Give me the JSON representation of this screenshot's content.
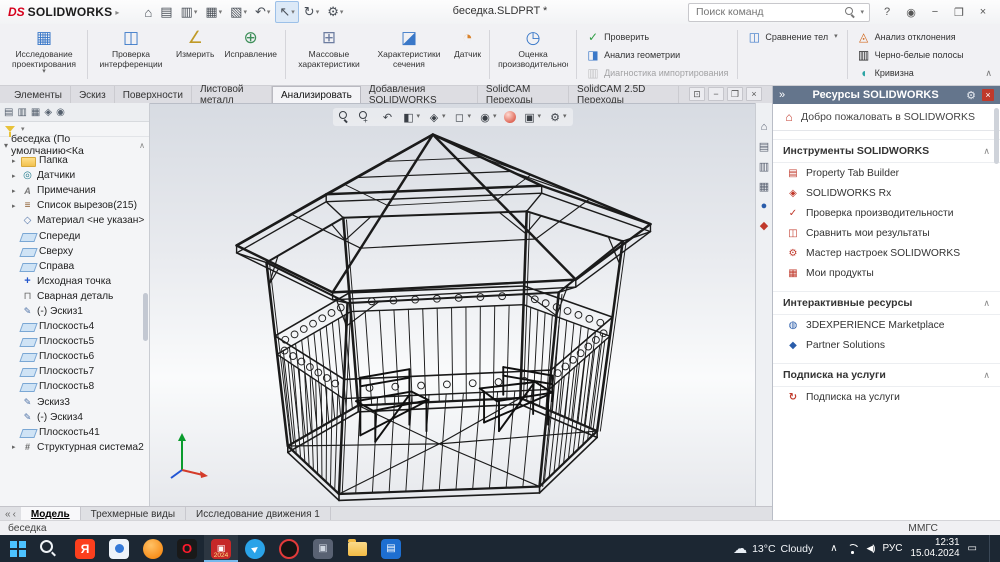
{
  "titlebar": {
    "brand_mark": "DS",
    "brand": "SOLIDWORKS",
    "doc_title": "беседка.SLDPRT *",
    "search_placeholder": "Поиск команд",
    "tools": [
      {
        "name": "home-icon",
        "glyph": "⌂"
      },
      {
        "name": "new-document-icon",
        "glyph": "▤"
      },
      {
        "name": "open-icon",
        "glyph": "▥",
        "dropdown": true
      },
      {
        "name": "save-icon",
        "glyph": "▦",
        "dropdown": true
      },
      {
        "name": "print-icon",
        "glyph": "▧",
        "dropdown": true
      },
      {
        "name": "undo-icon",
        "glyph": "↶",
        "dropdown": true
      },
      {
        "name": "select-icon",
        "glyph": "↖",
        "active": true,
        "dropdown": true
      },
      {
        "name": "rebuild-icon",
        "glyph": "↻",
        "dropdown": true
      },
      {
        "name": "options-icon",
        "glyph": "⚙",
        "dropdown": true
      }
    ],
    "window_controls": [
      {
        "name": "help-icon",
        "glyph": "?"
      },
      {
        "name": "user-icon",
        "glyph": "◉"
      },
      {
        "name": "minimize-icon",
        "glyph": "−"
      },
      {
        "name": "maximize-icon",
        "glyph": "❐"
      },
      {
        "name": "close-icon",
        "glyph": "×"
      }
    ]
  },
  "ribbon": {
    "groups": [
      [
        {
          "label": "Исследование проектирования",
          "icon": "design-study-icon",
          "dropdown": true
        }
      ],
      [
        {
          "label": "Проверка интерференции",
          "icon": "interference-check-icon"
        },
        {
          "label": "Измерить",
          "icon": "measure-icon"
        },
        {
          "label": "Исправление",
          "icon": "repair-icon"
        }
      ],
      [
        {
          "label": "Массовые характеристики",
          "icon": "mass-properties-icon"
        },
        {
          "label": "Характеристики сечения",
          "icon": "section-properties-icon"
        },
        {
          "label": "Датчик",
          "icon": "sensor-icon"
        }
      ],
      [
        {
          "label": "Оценка производительности",
          "icon": "performance-evaluation-icon"
        }
      ]
    ],
    "small_columns": [
      [
        {
          "label": "Проверить",
          "icon": "verify-icon"
        },
        {
          "label": "Анализ геометрии",
          "icon": "geometry-analysis-icon"
        },
        {
          "label": "Диагностика импортирования",
          "icon": "import-diagnostics-icon",
          "disabled": true
        }
      ],
      [
        {
          "label": "Сравнение тел",
          "icon": "compare-bodies-icon",
          "dropdown": true
        }
      ],
      [
        {
          "label": "Анализ отклонения",
          "icon": "deviation-analysis-icon"
        },
        {
          "label": "Черно-белые полосы",
          "icon": "zebra-stripes-icon"
        },
        {
          "label": "Кривизна",
          "icon": "curvature-icon"
        }
      ]
    ],
    "collapse_glyph": "∧"
  },
  "tabs": [
    {
      "label": "Элементы"
    },
    {
      "label": "Эскиз"
    },
    {
      "label": "Поверхности"
    },
    {
      "label": "Листовой металл"
    },
    {
      "label": "Анализировать",
      "active": true
    },
    {
      "label": "Добавления SOLIDWORKS"
    },
    {
      "label": "SolidCAM Переходы"
    },
    {
      "label": "SolidCAM 2.5D Переходы"
    }
  ],
  "doc_window_controls": [
    {
      "name": "doc-restore-icon",
      "glyph": "⊡"
    },
    {
      "name": "doc-minimize-icon",
      "glyph": "−"
    },
    {
      "name": "doc-maximize-icon",
      "glyph": "❐"
    },
    {
      "name": "doc-close-icon",
      "glyph": "×"
    }
  ],
  "feature_manager": {
    "root": "беседка (По умолчанию<Ка",
    "root_collapse_glyph": "∧",
    "tabs": [
      {
        "name": "feature-manager-tab-icon",
        "glyph": "▤"
      },
      {
        "name": "property-manager-tab-icon",
        "glyph": "▥"
      },
      {
        "name": "configuration-manager-tab-icon",
        "glyph": "▦"
      },
      {
        "name": "dimxpert-tab-icon",
        "glyph": "◈"
      },
      {
        "name": "display-manager-tab-icon",
        "glyph": "◉"
      }
    ],
    "items": [
      {
        "label": "Папка",
        "icon": "folder-icon",
        "expand": true
      },
      {
        "label": "Датчики",
        "icon": "sensors-icon",
        "expand": true
      },
      {
        "label": "Примечания",
        "icon": "annotations-folder-icon",
        "expand": true
      },
      {
        "label": "Список вырезов(215)",
        "icon": "cutlist-icon",
        "expand": true
      },
      {
        "label": "Материал <не указан>",
        "icon": "material-icon"
      },
      {
        "label": "Спереди",
        "icon": "plane-icon"
      },
      {
        "label": "Сверху",
        "icon": "plane-icon"
      },
      {
        "label": "Справа",
        "icon": "plane-icon"
      },
      {
        "label": "Исходная точка",
        "icon": "origin-icon"
      },
      {
        "label": "Сварная деталь",
        "icon": "weldment-icon"
      },
      {
        "label": "(-) Эскиз1",
        "icon": "sketch-icon"
      },
      {
        "label": "Плоскость4",
        "icon": "plane-icon"
      },
      {
        "label": "Плоскость5",
        "icon": "plane-icon"
      },
      {
        "label": "Плоскость6",
        "icon": "plane-icon"
      },
      {
        "label": "Плоскость7",
        "icon": "plane-icon"
      },
      {
        "label": "Плоскость8",
        "icon": "plane-icon"
      },
      {
        "label": "Эскиз3",
        "icon": "sketch-icon"
      },
      {
        "label": "(-) Эскиз4",
        "icon": "sketch-icon"
      },
      {
        "label": "Плоскость41",
        "icon": "plane-icon"
      },
      {
        "label": "Структурная система2",
        "icon": "structure-system-icon",
        "expand": true
      }
    ]
  },
  "viewport": {
    "toolbar": [
      {
        "name": "zoom-fit-icon",
        "style": "mag"
      },
      {
        "name": "zoom-area-icon",
        "style": "magp"
      },
      {
        "name": "previous-view-icon",
        "glyph": "↶"
      },
      {
        "name": "section-view-icon",
        "glyph": "◧",
        "dropdown": true
      },
      {
        "name": "annotations-visibility-icon",
        "glyph": "◈",
        "dropdown": true
      },
      {
        "name": "display-style-icon",
        "glyph": "◻",
        "dropdown": true
      },
      {
        "name": "hide-show-items-icon",
        "glyph": "◉",
        "dropdown": true
      },
      {
        "name": "edit-appearance-icon",
        "style": "ball"
      },
      {
        "name": "scene-icon",
        "glyph": "▣",
        "dropdown": true
      },
      {
        "name": "view-settings-icon",
        "glyph": "⚙",
        "dropdown": true
      }
    ]
  },
  "task_pane_strip": [
    {
      "name": "resources-tab-icon",
      "glyph": "⌂"
    },
    {
      "name": "design-library-icon",
      "glyph": "▤"
    },
    {
      "name": "file-explorer-tab-icon",
      "glyph": "▥"
    },
    {
      "name": "view-palette-icon",
      "glyph": "▦"
    },
    {
      "name": "appearances-icon",
      "glyph": "●",
      "cls": "blue"
    },
    {
      "name": "custom-properties-icon",
      "glyph": "◆",
      "cls": "red"
    }
  ],
  "task_pane": {
    "chevrons": "»",
    "title": "Ресурсы SOLIDWORKS",
    "welcome": {
      "label": "Добро пожаловать в SOLIDWORKS",
      "icon": "welcome-home-icon"
    },
    "sections": [
      {
        "title": "Инструменты SOLIDWORKS",
        "caret": "∧",
        "items": [
          {
            "label": "Property Tab Builder",
            "icon": "property-tab-builder-icon"
          },
          {
            "label": "SOLIDWORKS Rx",
            "icon": "solidworks-rx-icon"
          },
          {
            "label": "Проверка производительности",
            "icon": "performance-check-icon"
          },
          {
            "label": "Сравнить мои результаты",
            "icon": "compare-results-icon"
          },
          {
            "label": "Мастер настроек SOLIDWORKS",
            "icon": "copy-settings-icon"
          },
          {
            "label": "Мои продукты",
            "icon": "my-products-icon"
          }
        ]
      },
      {
        "title": "Интерактивные ресурсы",
        "caret": "∧",
        "items": [
          {
            "label": "3DEXPERIENCE Marketplace",
            "icon": "marketplace-icon"
          },
          {
            "label": "Partner Solutions",
            "icon": "partner-solutions-icon"
          }
        ]
      },
      {
        "title": "Подписка на услуги",
        "caret": "∧",
        "items": [
          {
            "label": "Подписка на услуги",
            "icon": "subscription-icon"
          }
        ]
      }
    ]
  },
  "model_tabs": [
    {
      "label": "Модель",
      "active": true
    },
    {
      "label": "Трехмерные виды"
    },
    {
      "label": "Исследование движения 1"
    }
  ],
  "statusbar": {
    "document": "беседка",
    "units": "ММГС"
  },
  "taskbar": {
    "apps": [
      {
        "name": "start-button",
        "cls": "start"
      },
      {
        "name": "search-button",
        "cls": "searchb"
      },
      {
        "name": "yandex-browser-icon",
        "cls": "yandex",
        "glyph": "Я"
      },
      {
        "name": "mail-app-icon",
        "cls": "lighttile"
      },
      {
        "name": "orange-app-icon",
        "cls": "orangec"
      },
      {
        "name": "opera-icon",
        "cls": "opera",
        "glyph": "O"
      },
      {
        "name": "screen-recorder-icon",
        "cls": "recorder",
        "badge": "2024",
        "open": true
      },
      {
        "name": "messenger-icon",
        "cls": "bluec"
      },
      {
        "name": "red-ring-app-icon",
        "cls": "redring"
      },
      {
        "name": "gray-app-icon",
        "cls": "graytile"
      },
      {
        "name": "file-explorer-icon",
        "cls": "folder"
      },
      {
        "name": "blue-app-icon",
        "cls": "bluetile"
      }
    ],
    "weather": {
      "temp": "13°C",
      "condition": "Cloudy"
    },
    "tray": {
      "hidden_glyph": "∧",
      "lang": "РУС",
      "time": "12:31",
      "date": "15.04.2024"
    }
  }
}
